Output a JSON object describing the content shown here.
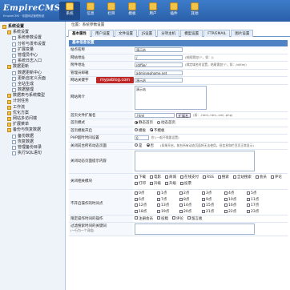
{
  "header": {
    "logo": "EmpireCMS",
    "logo_sub": "EmpireCMS · 帝国网站管理系统",
    "nav": [
      {
        "label": "系统",
        "active": true
      },
      {
        "label": "信息",
        "active": false
      },
      {
        "label": "栏目",
        "active": false
      },
      {
        "label": "模板",
        "active": false
      },
      {
        "label": "用户",
        "active": false
      },
      {
        "label": "插件",
        "active": false
      },
      {
        "label": "其他",
        "active": false
      }
    ]
  },
  "tree": [
    {
      "level": 1,
      "icon": "fold",
      "label": "系统设置"
    },
    {
      "level": 2,
      "icon": "fold",
      "label": "系统设置"
    },
    {
      "level": 3,
      "icon": "doc",
      "label": "系统参数设置"
    },
    {
      "level": 3,
      "icon": "doc",
      "label": "分析与发布设置"
    },
    {
      "level": 3,
      "icon": "doc",
      "label": "扩展变量"
    },
    {
      "level": 3,
      "icon": "doc",
      "label": "管理员中心"
    },
    {
      "level": 3,
      "icon": "doc",
      "label": "系统日志入口"
    },
    {
      "level": 2,
      "icon": "fold",
      "label": "数据更新"
    },
    {
      "level": 3,
      "icon": "doc",
      "label": "数据更新中心"
    },
    {
      "level": 3,
      "icon": "doc",
      "label": "更新自定义页面"
    },
    {
      "level": 3,
      "icon": "doc",
      "label": "全站生成"
    },
    {
      "level": 3,
      "icon": "doc",
      "label": "数据整理"
    },
    {
      "level": 2,
      "icon": "fold",
      "label": "数据表与系统模型"
    },
    {
      "level": 2,
      "icon": "fold",
      "label": "计划任务"
    },
    {
      "level": 2,
      "icon": "fold",
      "label": "工作流"
    },
    {
      "level": 2,
      "icon": "fold",
      "label": "优化方案"
    },
    {
      "level": 2,
      "icon": "fold",
      "label": "网站多访问端"
    },
    {
      "level": 2,
      "icon": "fold",
      "label": "扩展菜单"
    },
    {
      "level": 2,
      "icon": "fold",
      "label": "备份与恢复数据"
    },
    {
      "level": 3,
      "icon": "doc",
      "label": "备份数据"
    },
    {
      "level": 3,
      "icon": "doc",
      "label": "恢复数据"
    },
    {
      "level": 3,
      "icon": "doc",
      "label": "管理备份目录"
    },
    {
      "level": 3,
      "icon": "doc",
      "label": "执行SQL语句"
    }
  ],
  "breadcrumb": "位置：系统参数设置",
  "tabs": [
    {
      "label": "基本属性",
      "active": true
    },
    {
      "label": "用户设置",
      "active": false
    },
    {
      "label": "文件设置",
      "active": false
    },
    {
      "label": "JS设置",
      "active": false
    },
    {
      "label": "分项主机",
      "active": false
    },
    {
      "label": "模型设置",
      "active": false
    },
    {
      "label": "FTP/EMAIL",
      "active": false
    },
    {
      "label": "图片设置",
      "active": false
    }
  ],
  "section_title": "基本信息设置",
  "watermark": "mypablog.com",
  "form": {
    "site_name": {
      "label": "站点名称",
      "value": "演示站"
    },
    "site_url": {
      "label": "网站地址",
      "value": "/",
      "hint": "(结尾需加\"/\"，如：/)"
    },
    "attach_url": {
      "label": "附件地址",
      "value": "/d/file/",
      "hint": "(绑定域名时设置，结尾需加\"/\"，如：/d/file/)"
    },
    "admin_email": {
      "label": "管理员邮箱",
      "value": "admin@phome.net"
    },
    "keywords": {
      "label": "网站关键字",
      "value": "演示站"
    },
    "description": {
      "label": "网站简介",
      "value": "演示站"
    },
    "index_ext": {
      "label": "首页文件扩展名",
      "value": ".html",
      "button": "扩展名",
      "hint": "(如：.html,.htm,.xml,.php)"
    },
    "index_mode": {
      "label": "首页模式",
      "options": [
        "静态首页",
        "动态首页"
      ],
      "selected": 0
    },
    "index_open": {
      "label": "首页模板开启",
      "options": [
        "模板",
        "不模板"
      ],
      "selected": 1
    },
    "php_timeout": {
      "label": "PHP超时时间设置",
      "value": "0",
      "hint": "秒 (一般不需要设置)"
    },
    "close_site": {
      "label": "关闭前台所有动态页面",
      "options": [
        "是",
        "否"
      ],
      "selected": 1,
      "hint": "(如果开启，前台所有动态页面将无法使用，但信息和栏目页正常显示)"
    },
    "close_tip": {
      "label": "关闭动态页面提示内容",
      "value": ""
    },
    "close_modules": {
      "label": "关闭相关模块",
      "items": [
        "下载",
        "电影",
        "商城",
        "在线支付",
        "RSS",
        "搜索",
        "全站搜索",
        "会员",
        "评论",
        "打印",
        "升级",
        "升级",
        "投票"
      ]
    },
    "no_hours": {
      "label": "不开启操作的时间点",
      "hours": [
        "0点",
        "1点",
        "2点",
        "3点",
        "4点",
        "5点",
        "6点",
        "7点",
        "8点",
        "9点",
        "10点",
        "11点",
        "12点",
        "13点",
        "14点",
        "15点",
        "16点",
        "17点",
        "18点",
        "19点",
        "20点",
        "21点",
        "22点",
        "23点"
      ]
    },
    "limit_ops": {
      "label": "限定操作时间的操作",
      "items": [
        "注册会员",
        "投稿",
        "评论",
        "留言板"
      ]
    },
    "disallow_words": {
      "label": "过滤搜索时间的关键词",
      "sub": "(一行为一个词组)",
      "value": ""
    }
  }
}
